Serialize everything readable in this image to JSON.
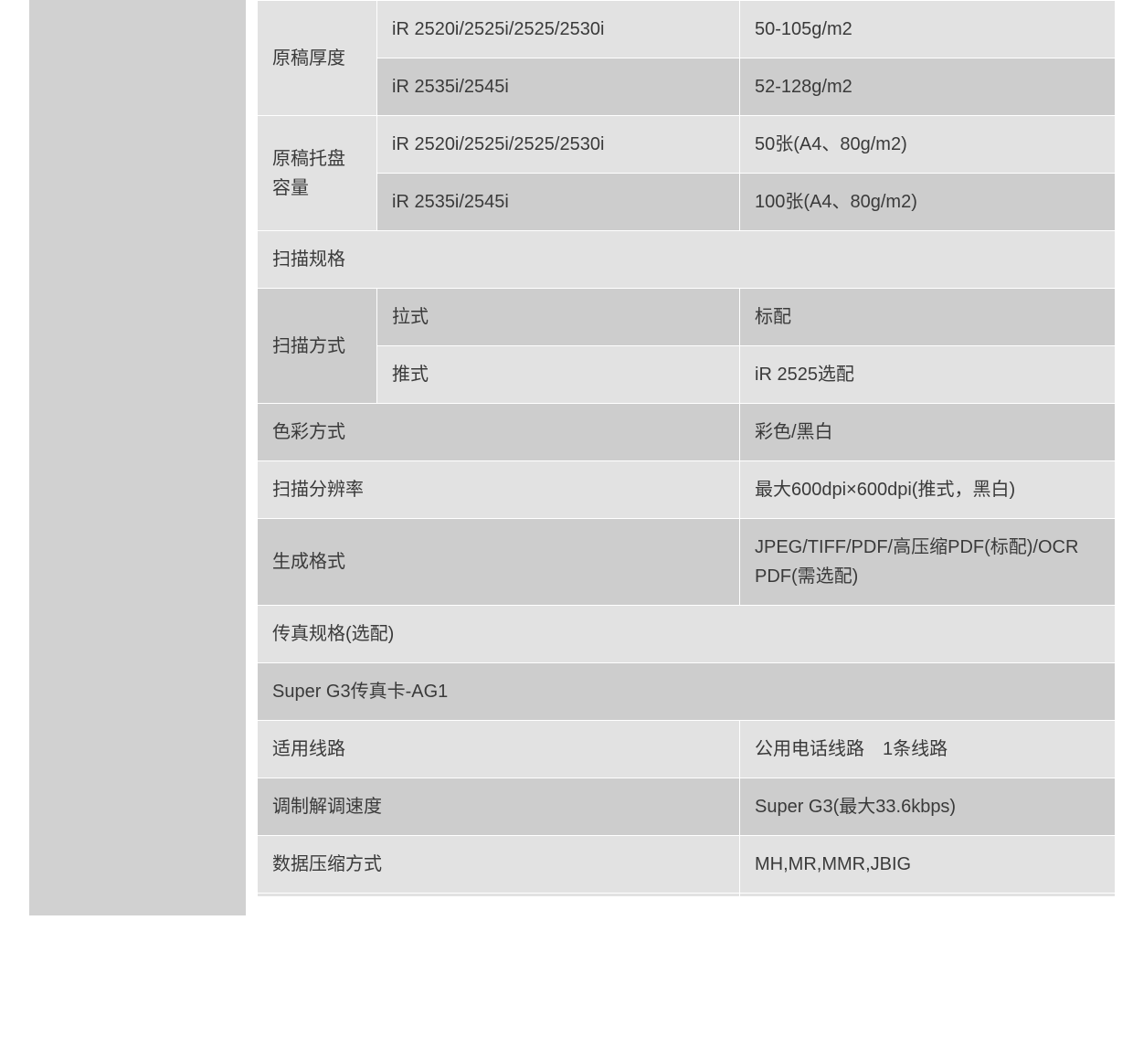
{
  "rows": {
    "thickness": {
      "label": "原稿厚度",
      "a_model": "iR 2520i/2525i/2525/2530i",
      "a_value": "50-105g/m2",
      "b_model": "iR 2535i/2545i",
      "b_value": "52-128g/m2"
    },
    "tray": {
      "label": "原稿托盘容量",
      "a_model": "iR 2520i/2525i/2525/2530i",
      "a_value": "50张(A4、80g/m2)",
      "b_model": "iR 2535i/2545i",
      "b_value": "100张(A4、80g/m2)"
    },
    "scan_spec": "扫描规格",
    "scan_method": {
      "label": "扫描方式",
      "a_name": "拉式",
      "a_value": "标配",
      "b_name": "推式",
      "b_value": "iR 2525选配"
    },
    "color_mode": {
      "label": "色彩方式",
      "value": "彩色/黑白"
    },
    "resolution": {
      "label": "扫描分辨率",
      "value": "最大600dpi×600dpi(推式，黑白)"
    },
    "format": {
      "label": "生成格式",
      "value": "JPEG/TIFF/PDF/高压缩PDF(标配)/OCR PDF(需选配)"
    },
    "fax_spec": "传真规格(选配)",
    "fax_card": "Super G3传真卡-AG1",
    "line": {
      "label": "适用线路",
      "value": "公用电话线路　1条线路"
    },
    "modem": {
      "label": "调制解调速度",
      "value": "Super G3(最大33.6kbps)"
    },
    "compression": {
      "label": "数据压缩方式",
      "value": "MH,MR,MMR,JBIG"
    }
  }
}
